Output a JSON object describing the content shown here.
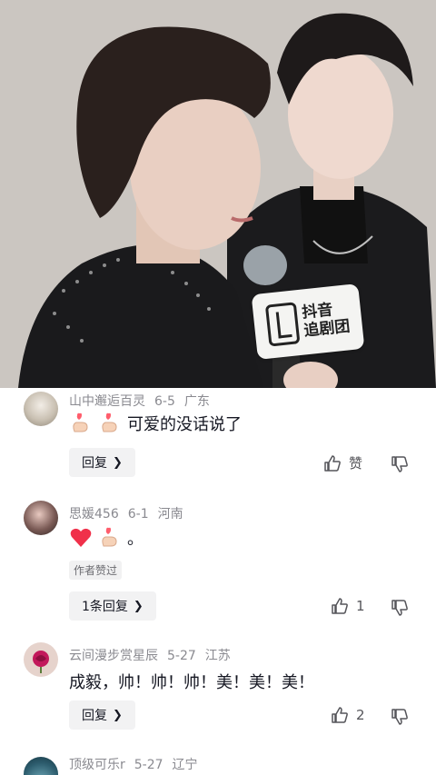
{
  "video": {
    "mic_brand_line1": "抖音",
    "mic_brand_line2": "追剧团"
  },
  "comments": [
    {
      "user": "山中邂逅百灵",
      "date": "6-5",
      "location": "广东",
      "text": "可爱的没话说了",
      "emojis": [
        "finger-heart",
        "finger-heart"
      ],
      "reply_label": "回复",
      "like_label": "赞",
      "avatar_color": "#c9c0b2"
    },
    {
      "user": "思媛456",
      "date": "6-1",
      "location": "河南",
      "text": "。",
      "emojis": [
        "red-heart",
        "finger-heart"
      ],
      "badge": "作者赞过",
      "reply_label": "1条回复",
      "like_count": "1",
      "avatar_color": "#7a5a55"
    },
    {
      "user": "云间漫步赏星辰",
      "date": "5-27",
      "location": "江苏",
      "text": "成毅，帅！帅！帅！美！美！美！",
      "reply_label": "回复",
      "like_count": "2",
      "avatar_color": "#e6d3cc"
    },
    {
      "user": "顶级可乐r",
      "date": "5-27",
      "location": "辽宁",
      "avatar_color": "#2d5d6e"
    }
  ]
}
